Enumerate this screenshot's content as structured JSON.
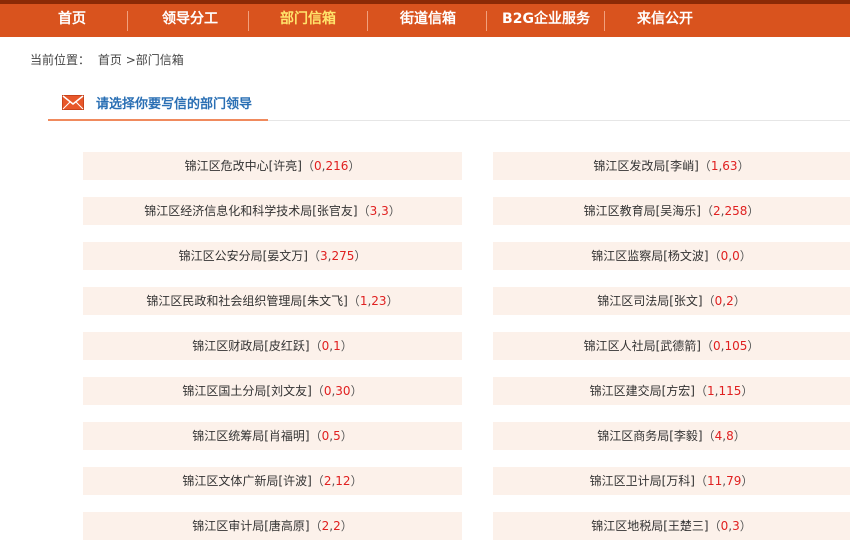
{
  "nav": {
    "items": [
      {
        "label": "首页",
        "active": false
      },
      {
        "label": "领导分工",
        "active": false
      },
      {
        "label": "部门信箱",
        "active": true
      },
      {
        "label": "街道信箱",
        "active": false
      },
      {
        "label": "B2G企业服务",
        "active": false
      },
      {
        "label": "来信公开",
        "active": false
      }
    ]
  },
  "breadcrumb": {
    "prefix": "当前位置：",
    "home": "首页",
    "current": ">部门信箱"
  },
  "section": {
    "title": "请选择你要写信的部门领导"
  },
  "departments": [
    {
      "name": "锦江区危改中心",
      "leader": "[许亮]",
      "a": "0",
      "b": "216"
    },
    {
      "name": "锦江区发改局",
      "leader": "[李峭]",
      "a": "1",
      "b": "63"
    },
    {
      "name": "锦江区经济信息化和科学技术局",
      "leader": "[张官友]",
      "a": "3",
      "b": "3"
    },
    {
      "name": "锦江区教育局",
      "leader": "[吴海乐]",
      "a": "2",
      "b": "258"
    },
    {
      "name": "锦江区公安分局",
      "leader": "[晏文万]",
      "a": "3",
      "b": "275"
    },
    {
      "name": "锦江区监察局",
      "leader": "[杨文波]",
      "a": "0",
      "b": "0"
    },
    {
      "name": "锦江区民政和社会组织管理局",
      "leader": "[朱文飞]",
      "a": "1",
      "b": "23"
    },
    {
      "name": "锦江区司法局",
      "leader": "[张文]",
      "a": "0",
      "b": "2"
    },
    {
      "name": "锦江区财政局",
      "leader": "[皮红跃]",
      "a": "0",
      "b": "1"
    },
    {
      "name": "锦江区人社局",
      "leader": "[武德箭]",
      "a": "0",
      "b": "105"
    },
    {
      "name": "锦江区国土分局",
      "leader": "[刘文友]",
      "a": "0",
      "b": "30"
    },
    {
      "name": "锦江区建交局",
      "leader": "[方宏]",
      "a": "1",
      "b": "115"
    },
    {
      "name": "锦江区统筹局",
      "leader": "[肖福明]",
      "a": "0",
      "b": "5"
    },
    {
      "name": "锦江区商务局",
      "leader": "[李毅]",
      "a": "4",
      "b": "8"
    },
    {
      "name": "锦江区文体广新局",
      "leader": "[许波]",
      "a": "2",
      "b": "12"
    },
    {
      "name": "锦江区卫计局",
      "leader": "[万科]",
      "a": "11",
      "b": "79"
    },
    {
      "name": "锦江区审计局",
      "leader": "[唐高原]",
      "a": "2",
      "b": "2"
    },
    {
      "name": "锦江区地税局",
      "leader": "[王楚三]",
      "a": "0",
      "b": "3"
    }
  ],
  "colors": {
    "nav_bg": "#d9531e",
    "nav_active": "#ffe36b",
    "item_bg": "#fcf1ea",
    "count": "#e02020",
    "title": "#2a6fb4"
  }
}
